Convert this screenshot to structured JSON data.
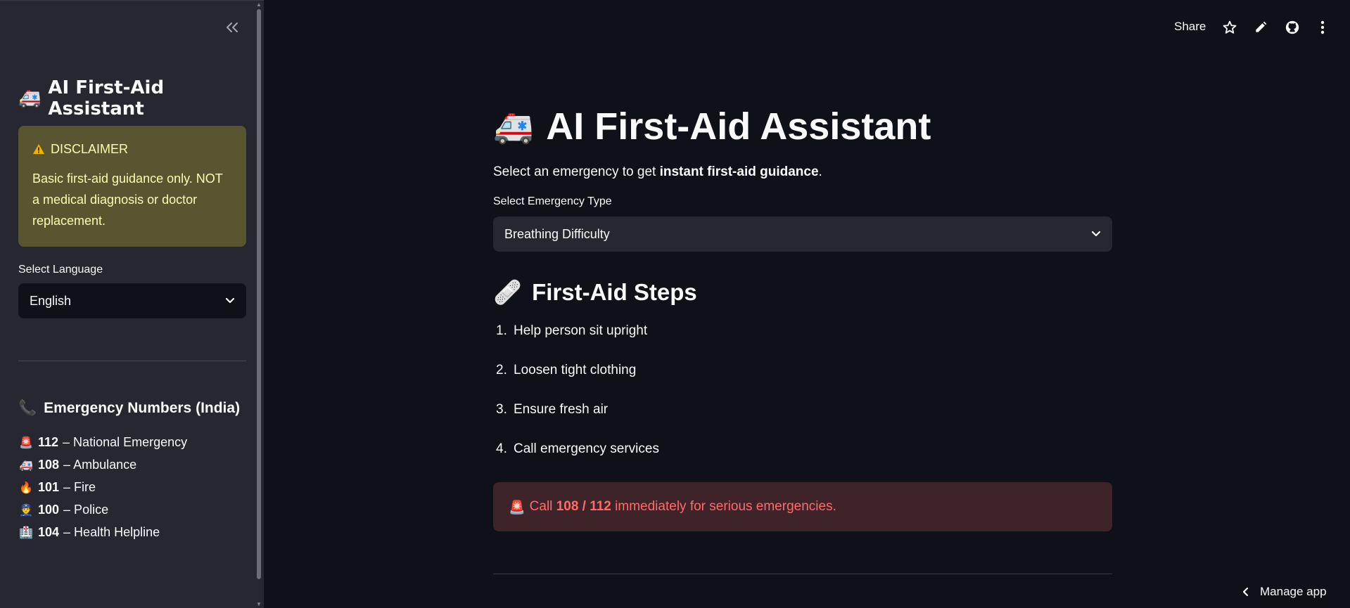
{
  "sidebar": {
    "collapse_icon": "double-chevron-left-icon",
    "title_emoji": "🚑",
    "title": "AI First-Aid Assistant",
    "disclaimer": {
      "icon": "warning-icon",
      "heading": "DISCLAIMER",
      "body": "Basic first-aid guidance only. NOT a medical diagnosis or doctor replacement."
    },
    "language_label": "Select Language",
    "language_value": "English",
    "emergency_title_emoji": "📞",
    "emergency_title": "Emergency Numbers (India)",
    "numbers": [
      {
        "emoji": "🚨",
        "number": "112",
        "label": "– National Emergency"
      },
      {
        "emoji": "🚑",
        "number": "108",
        "label": "– Ambulance"
      },
      {
        "emoji": "🔥",
        "number": "101",
        "label": "– Fire"
      },
      {
        "emoji": "👮",
        "number": "100",
        "label": "– Police"
      },
      {
        "emoji": "🏥",
        "number": "104",
        "label": "– Health Helpline"
      }
    ]
  },
  "toolbar": {
    "share_label": "Share",
    "icons": [
      "star-icon",
      "pencil-icon",
      "github-icon",
      "more-vertical-icon"
    ]
  },
  "main": {
    "title_emoji": "🚑",
    "title": "AI First-Aid Assistant",
    "intro_prefix": "Select an emergency to get ",
    "intro_bold": "instant first-aid guidance",
    "intro_suffix": ".",
    "emergency_label": "Select Emergency Type",
    "emergency_value": "Breathing Difficulty",
    "steps_emoji": "🩹",
    "steps_title": "First-Aid Steps",
    "steps": [
      {
        "num": "1.",
        "text": "Help person sit upright"
      },
      {
        "num": "2.",
        "text": "Loosen tight clothing"
      },
      {
        "num": "3.",
        "text": "Ensure fresh air"
      },
      {
        "num": "4.",
        "text": "Call emergency services"
      }
    ],
    "alert": {
      "emoji": "🚨",
      "prefix": "Call ",
      "bold": "108 / 112",
      "suffix": " immediately for serious emergencies."
    }
  },
  "footer": {
    "manage_label": "Manage app"
  },
  "colors": {
    "sidebar_bg": "#262730",
    "main_bg": "#0e1117",
    "disclaimer_bg": "#575631",
    "disclaimer_text": "#fdfdb0",
    "alert_bg": "#3e2429",
    "alert_text": "#ff6b6b"
  }
}
